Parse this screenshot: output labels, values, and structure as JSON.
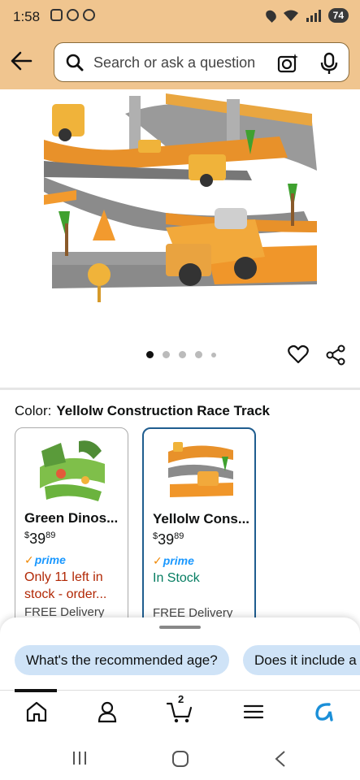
{
  "status": {
    "time": "1:58",
    "battery": "74"
  },
  "search": {
    "placeholder": "Search or ask a question"
  },
  "carousel": {
    "pages": 5,
    "active": 0
  },
  "color": {
    "label": "Color:",
    "value": "Yellolw Construction Race Track"
  },
  "options": [
    {
      "name": "Green Dinos...",
      "price_dollars": "39",
      "price_cents": "89",
      "currency": "$",
      "prime": "prime",
      "stock": "Only 11 left in stock - order...",
      "delivery": "FREE Delivery",
      "selected": false
    },
    {
      "name": "Yellolw Cons...",
      "price_dollars": "39",
      "price_cents": "89",
      "currency": "$",
      "prime": "prime",
      "stock": "In Stock",
      "delivery": "FREE Delivery",
      "selected": true
    }
  ],
  "chips": [
    "What's the recommended age?",
    "Does it include a"
  ],
  "nav": {
    "cart_count": "2"
  },
  "colors": {
    "header_bg": "#f0c58f",
    "prime_blue": "#1a98ff",
    "stock_red": "#b12704",
    "stock_green": "#067d62",
    "chip_bg": "#cfe3f7",
    "selected_border": "#1f5d8f"
  }
}
